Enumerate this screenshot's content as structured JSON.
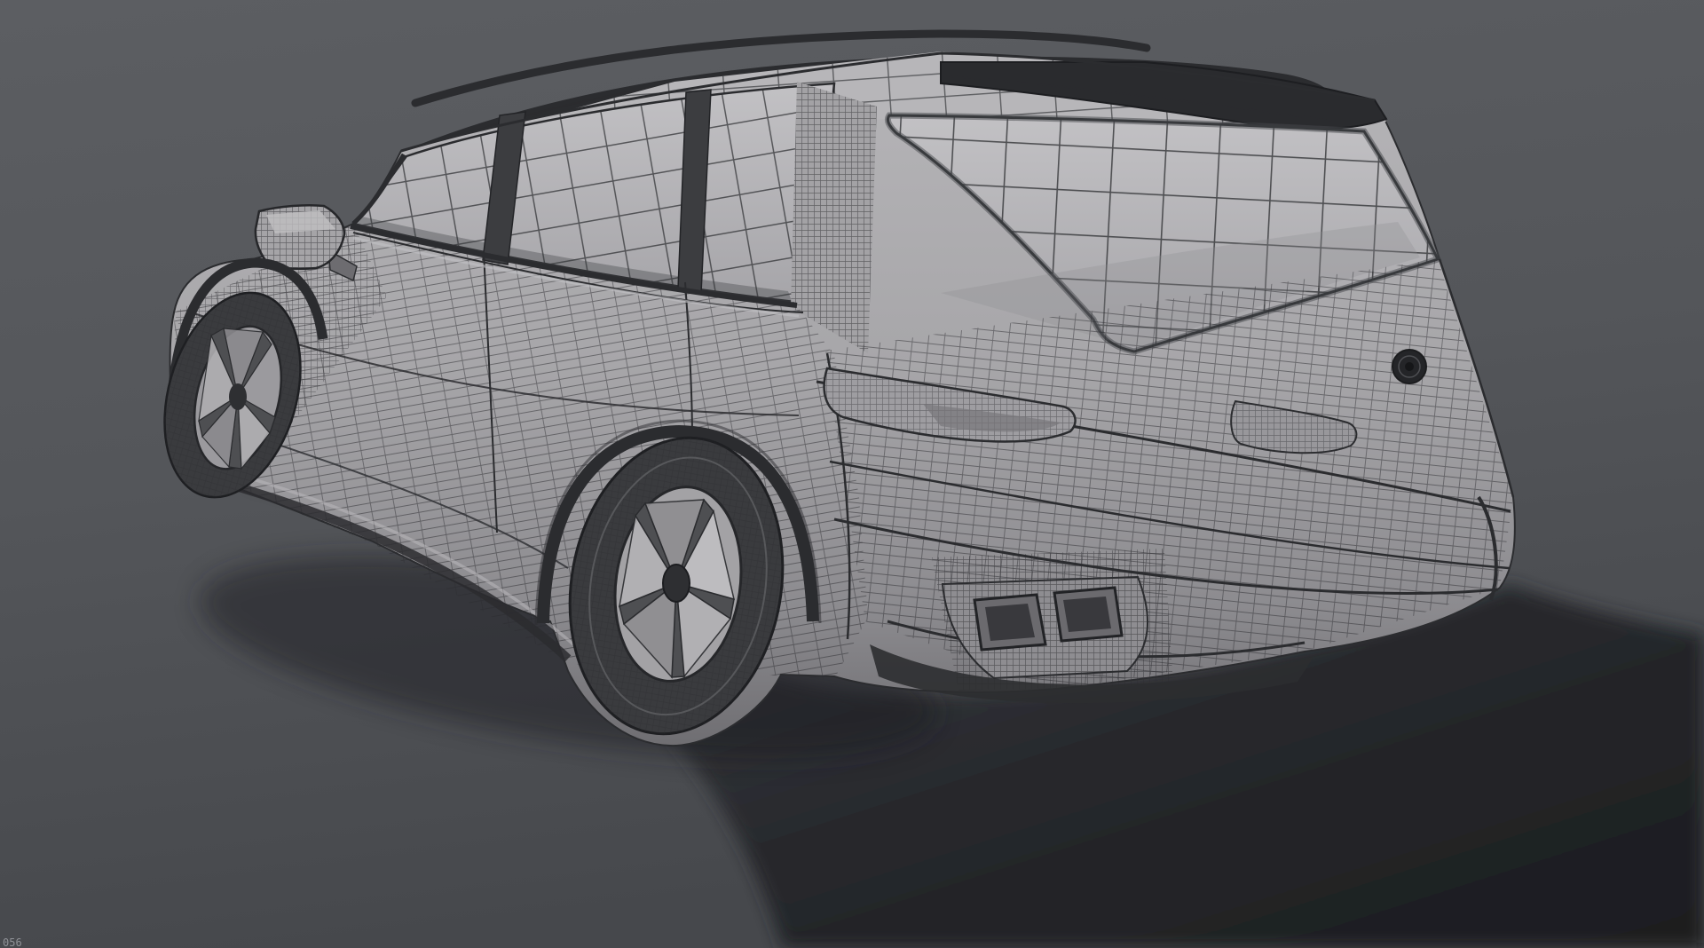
{
  "hud": {
    "frame_counter": "056"
  },
  "scene": {
    "subject": "wireframe-suv-3d-model",
    "view": "rear-three-quarter-left",
    "render_mode": "wireframe-on-shaded"
  },
  "colors": {
    "bg-top": "#5c5e62",
    "bg-mid": "#54565a",
    "bg-bottom": "#46484c",
    "shadow-near": "#3a3c40",
    "shadow-deep": "#1b1c1f",
    "body": "#a9a8ab",
    "body-light": "#bfbec1",
    "body-dark": "#7e7d81",
    "glass": "#b6b5b8",
    "line": "#2b2c2f",
    "trim-dark": "#232427",
    "tire": "#3a3b3e",
    "rim": "#a5a4a7",
    "hud-text": "#909297"
  }
}
